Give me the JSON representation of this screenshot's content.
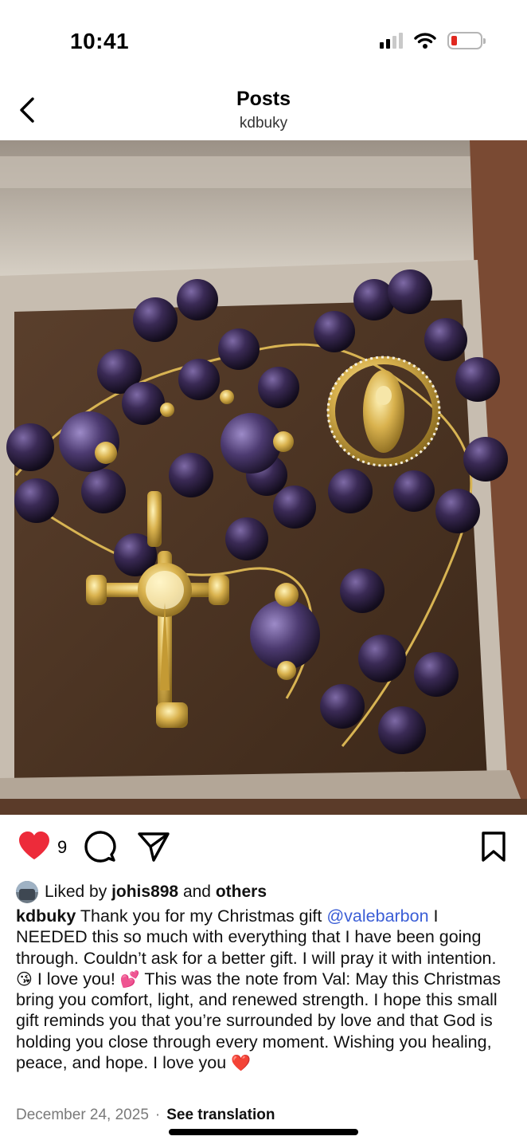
{
  "status_bar": {
    "time": "10:41",
    "icons": [
      "cellular-signal-icon",
      "wifi-icon",
      "battery-low-icon"
    ]
  },
  "header": {
    "back_icon": "chevron-left-icon",
    "title": "Posts",
    "subtitle": "kdbuky"
  },
  "post": {
    "image_content": "rosary-in-gift-box-photo",
    "actions": {
      "like_icon": "heart-filled-icon",
      "like_color": "#ed2b3a",
      "like_count": "9",
      "comment_icon": "comment-bubble-icon",
      "share_icon": "paper-plane-icon",
      "save_icon": "bookmark-icon"
    },
    "liked_by": {
      "prefix": "Liked by",
      "user": "johis898",
      "connector": "and",
      "others": "others"
    },
    "caption": {
      "author": "kdbuky",
      "text_1": "Thank you for my Christmas gift",
      "mention": "@valebarbon",
      "text_2": "I NEEDED this so much with everything that I have been going through. Couldn’t ask for a better gift. I will pray it with intention.",
      "emoji_1": "😘",
      "text_3": "I love you!",
      "emoji_2": "💕",
      "text_4": "This was the note from Val: May this Christmas bring you comfort, light, and renewed strength. I hope this small gift reminds you that you’re surrounded by love and that God is holding you close through every moment. Wishing you healing, peace, and hope. I love you",
      "emoji_3": "❤️"
    },
    "date": "December 24, 2025",
    "separator": "·",
    "translate_label": "See translation"
  },
  "colors": {
    "mention": "#3b5ed6",
    "muted_text": "#7a7a7a"
  }
}
